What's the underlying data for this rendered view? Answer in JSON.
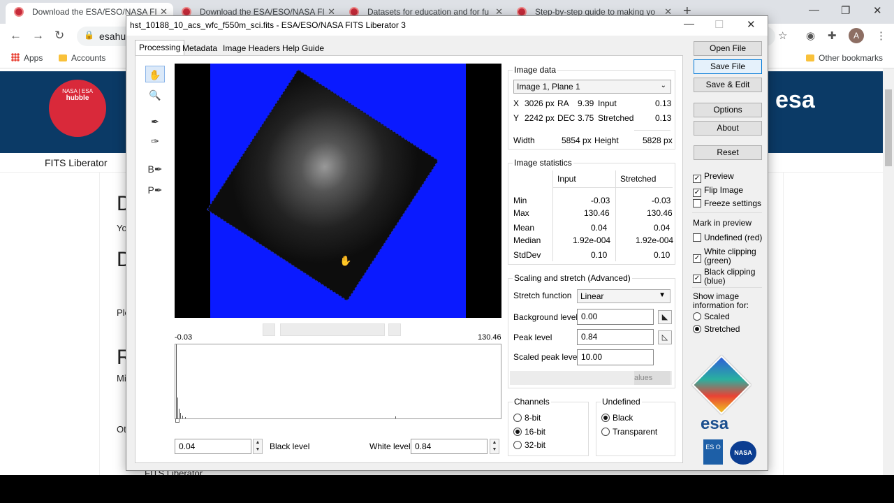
{
  "browser": {
    "tabs": [
      {
        "title": "Download the ESA/ESO/NASA FI",
        "active": true
      },
      {
        "title": "Download the ESA/ESO/NASA FI",
        "active": false
      },
      {
        "title": "Datasets for education and for fu",
        "active": false
      },
      {
        "title": "Step-by-step guide to making yo",
        "active": false
      }
    ],
    "url": "esahu",
    "bookmarks": {
      "apps": "Apps",
      "accounts": "Accounts",
      "other": "Other bookmarks"
    },
    "avatar_letter": "A"
  },
  "webpage": {
    "hubble_logo_top": "NASA | ESA",
    "hubble_logo_name": "hubble",
    "esa_logo": "esa",
    "header_title": "FITS Liberator",
    "fragments": [
      "D",
      "Yo",
      "D",
      "Ple",
      "R",
      "Mi",
      "Ot"
    ],
    "footer_peek": "FITS Liberator"
  },
  "fits": {
    "window_title": "hst_10188_10_acs_wfc_f550m_sci.fits - ESA/ESO/NASA FITS Liberator 3",
    "tabs": [
      "Processing",
      "Metadata",
      "Image Headers",
      "Help Guide"
    ],
    "tools": [
      {
        "name": "hand-tool",
        "glyph": "✋"
      },
      {
        "name": "zoom-tool",
        "glyph": "🔍"
      },
      {
        "name": "picker-tool",
        "glyph": "⁄"
      },
      {
        "name": "picker-plus-tool",
        "glyph": "⁄"
      },
      {
        "name": "black-picker-tool",
        "glyph": "B⁄"
      },
      {
        "name": "peak-picker-tool",
        "glyph": "P⁄"
      }
    ],
    "histogram": {
      "min_label": "-0.03",
      "max_label": "130.46",
      "black_value": "0.04",
      "black_label": "Black level",
      "white_label": "White level",
      "white_value": "0.84"
    },
    "image_data": {
      "title": "Image data",
      "plane": "Image 1, Plane 1",
      "x_label": "X",
      "x_value": "3026 px",
      "ra_label": "RA",
      "ra_value": "9.39",
      "input_label": "Input",
      "input_value": "0.13",
      "y_label": "Y",
      "y_value": "2242 px",
      "dec_label": "DEC",
      "dec_value": "3.75",
      "stretched_label": "Stretched",
      "stretched_value": "0.13",
      "width_label": "Width",
      "width_value": "5854 px",
      "height_label": "Height",
      "height_value": "5828 px"
    },
    "stats": {
      "title": "Image statistics",
      "col_input": "Input",
      "col_stretched": "Stretched",
      "rows": [
        {
          "label": "Min",
          "input": "-0.03",
          "stretched": "-0.03"
        },
        {
          "label": "Max",
          "input": "130.46",
          "stretched": "130.46"
        },
        {
          "label": "Mean",
          "input": "0.04",
          "stretched": "0.04"
        },
        {
          "label": "Median",
          "input": "1.92e-004",
          "stretched": "1.92e-004"
        },
        {
          "label": "StdDev",
          "input": "0.10",
          "stretched": "0.10"
        }
      ]
    },
    "scaling": {
      "title": "Scaling and stretch (Advanced)",
      "stretch_label": "Stretch function",
      "stretch_value": "Linear",
      "background_label": "Background level",
      "background_value": "0.00",
      "peak_label": "Peak level",
      "peak_value": "0.84",
      "scaled_peak_label": "Scaled peak level",
      "scaled_peak_value": "10.00",
      "values_button": "alues"
    },
    "channels": {
      "title": "Channels",
      "options": [
        "8-bit",
        "16-bit",
        "32-bit"
      ],
      "selected": "16-bit"
    },
    "undefined": {
      "title": "Undefined",
      "options": [
        "Black",
        "Transparent"
      ],
      "selected": "Black"
    },
    "buttons": {
      "open": "Open File",
      "save": "Save File",
      "save_edit": "Save & Edit",
      "options": "Options",
      "about": "About",
      "reset": "Reset"
    },
    "options": {
      "preview": "Preview",
      "flip": "Flip Image",
      "freeze": "Freeze settings",
      "mark_title": "Mark in preview",
      "undefined_red": "Undefined (red)",
      "white_clip_1": "White clipping",
      "white_clip_2": "(green)",
      "black_clip_1": "Black clipping",
      "black_clip_2": "(blue)",
      "show_info_1": "Show image",
      "show_info_2": "information for:",
      "scaled": "Scaled",
      "stretched": "Stretched"
    },
    "logos": {
      "esa": "esa",
      "eso": "ES O",
      "nasa": "NASA"
    },
    "colors": {
      "preview_blue": "#0a1aff",
      "accent_focus": "#0078d7"
    }
  }
}
